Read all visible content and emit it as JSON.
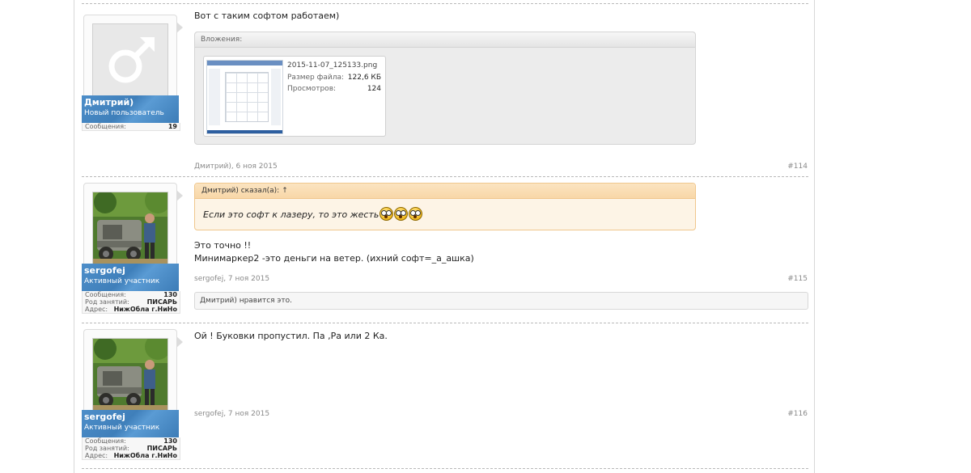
{
  "posts": [
    {
      "author": "Дмитрий)",
      "user_title": "Новый пользователь",
      "stats": [
        {
          "label": "Сообщения:",
          "value": "19"
        }
      ],
      "message": "Вот с таким софтом работаем)",
      "attachments_header": "Вложения:",
      "attachment": {
        "filename": "2015-11-07_125133.png",
        "size_label": "Размер файла:",
        "size_value": "122,6 КБ",
        "views_label": "Просмотров:",
        "views_value": "124"
      },
      "meta": "Дмитрий), 6 ноя 2015",
      "number": "#114"
    },
    {
      "author": "sergofej",
      "user_title": "Активный участник",
      "stats": [
        {
          "label": "Сообщения:",
          "value": "130"
        },
        {
          "label": "Род занятий:",
          "value": "ПИСАРЬ"
        },
        {
          "label": "Адрес:",
          "value": "НижОбла г.НиНо"
        }
      ],
      "quote_author": "Дмитрий) сказал(а):",
      "quote_arrow": "↑",
      "quote_text": "Если это софт к лазеру, то это жесть",
      "quote_smileys": [
        "shocked-smiley-icon",
        "shocked-smiley-icon",
        "shocked-smiley-icon"
      ],
      "message_lines": [
        "Это точно !!",
        "Минимаркер2 -это деньги на ветер. (ихний софт=_а_ашка)"
      ],
      "meta": "sergofej, 7 ноя 2015",
      "number": "#115",
      "likes": "Дмитрий) нравится это."
    },
    {
      "author": "sergofej",
      "user_title": "Активный участник",
      "stats": [
        {
          "label": "Сообщения:",
          "value": "130"
        },
        {
          "label": "Род занятий:",
          "value": "ПИСАРЬ"
        },
        {
          "label": "Адрес:",
          "value": "НижОбла г.НиНо"
        }
      ],
      "message": "Ой ! Буковки пропустил. Па ,Ра или 2 Ка.",
      "meta": "sergofej, 7 ноя 2015",
      "number": "#116"
    }
  ],
  "colors": {
    "namebar": "#4d8ec9",
    "quote_bg": "#fdf4e6",
    "quote_border": "#f0c78d"
  }
}
